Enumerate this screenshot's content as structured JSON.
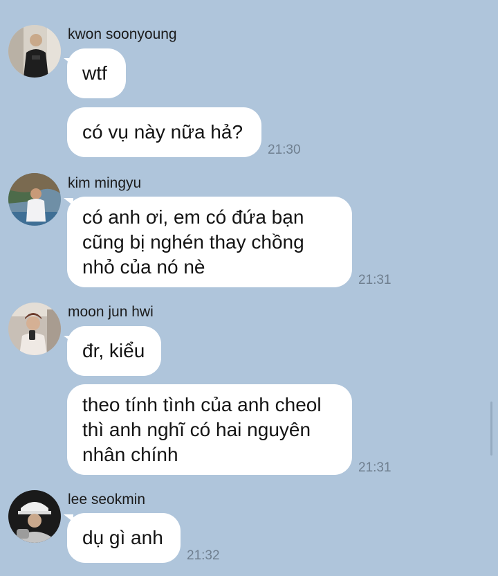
{
  "theme": {
    "background": "#afc5db",
    "bubble": "#ffffff",
    "timestamp": "#6f7f8f"
  },
  "messages": [
    {
      "sender": "kwon soonyoung",
      "avatar_icon": "user-avatar-icon",
      "bubbles": [
        {
          "lines": [
            "wtf"
          ]
        },
        {
          "lines": [
            "có vụ này nữa hả?"
          ]
        }
      ],
      "time": "21:30"
    },
    {
      "sender": "kim mingyu",
      "avatar_icon": "user-avatar-icon",
      "bubbles": [
        {
          "lines": [
            "có anh ơi, em có đứa bạn",
            "cũng bị nghén thay chồng",
            "nhỏ của nó nè"
          ]
        }
      ],
      "time": "21:31"
    },
    {
      "sender": "moon jun hwi",
      "avatar_icon": "user-avatar-icon",
      "bubbles": [
        {
          "lines": [
            "đr, kiểu"
          ]
        },
        {
          "lines": [
            "theo tính tình của anh cheol",
            "thì anh nghĩ có hai nguyên",
            "nhân chính"
          ]
        }
      ],
      "time": "21:31"
    },
    {
      "sender": "lee seokmin",
      "avatar_icon": "user-avatar-icon",
      "bubbles": [
        {
          "lines": [
            "dụ gì anh"
          ]
        }
      ],
      "time": "21:32"
    }
  ]
}
